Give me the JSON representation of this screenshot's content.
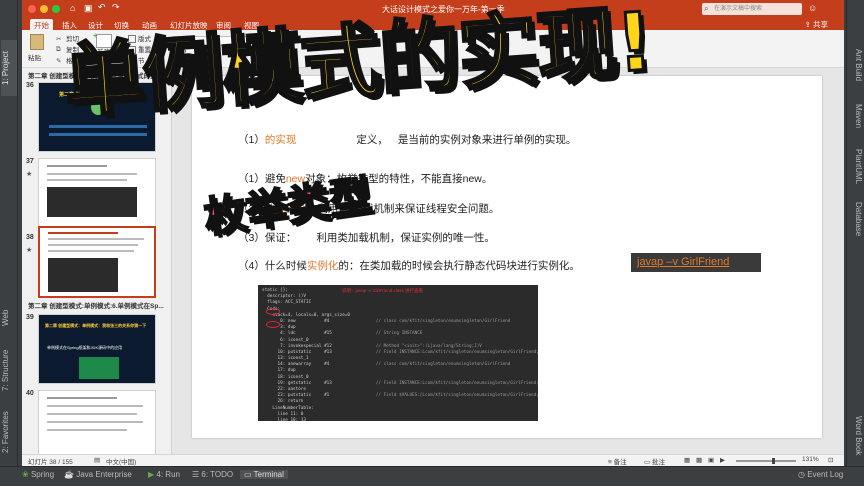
{
  "ide": {
    "left_tabs": [
      "1: Project",
      "7: Structure",
      "Web",
      "2: Favorites"
    ],
    "right_tabs": [
      "Ant Build",
      "Maven",
      "PlantUML",
      "Database",
      "Word Book"
    ],
    "bottom_tabs": [
      "Spring",
      "Java Enterprise",
      "4: Run",
      "6: TODO",
      "Terminal",
      "Event Log"
    ]
  },
  "ppt": {
    "doc_title": "大话设计模式之爱你一万年-第一季",
    "search_placeholder": "在演示文稿中搜索",
    "share_label": "共享",
    "ribbon_tabs": [
      "开始",
      "插入",
      "设计",
      "切换",
      "动画",
      "幻灯片放映",
      "审阅",
      "视图"
    ],
    "ribbon": {
      "paste": "粘贴",
      "cut": "剪切",
      "copy": "复制",
      "format": "格式",
      "new_slide": "新建\n幻灯片",
      "layout": "版式",
      "reset": "重置",
      "section": "节"
    },
    "section_38_label": "第二章 创建型模式:单例模式:5.单例模式的实...",
    "section_39_label": "第二章 创建型模式:单例模式:6.单例模式在Sp...",
    "slide_numbers": [
      "36",
      "37",
      "38",
      "39",
      "40"
    ],
    "thumb36_text": "第二章 创建型模式：单例模式",
    "thumb39_title": "第二章 创建型模式：单例模式：我和张三的关系你猜一下",
    "thumb39_sub": "单例模式在Spring框架和JDK源码中的应用",
    "status": {
      "slide_info": "幻灯片 38 / 155",
      "language": "中文(中国)",
      "notes": "备注",
      "comments": "批注",
      "zoom": "131%"
    }
  },
  "slide": {
    "line1_a": "（1）",
    "line1_b": "的实现",
    "line1_c": "定义，",
    "line1_d": "是当前的实例对象来进行单例的实现。",
    "line2_a": "（1）",
    "line2_b": "避免",
    "line2_c": "new",
    "line2_d": "对象：枚举类型的特性，不能直接",
    "line2_e": "new。",
    "line3_a": "（2）",
    "line3_b": "线程安全",
    "line3_c": "：利用",
    "line3_d": "加载机制来保证线程安全问题。",
    "line4_a": "（3）",
    "line4_b": "保证",
    "line4_c": "：",
    "line4_d": "利用类加载机制，保证实例的唯一性。",
    "line5_a": "（4）什么时候",
    "line5_b": "实例化",
    "line5_c": "的：在类加载的时候会执行静态代码块进行实例化。",
    "javap_label": "javap –v GirlFriend",
    "code_lines": [
      "static {};",
      "  descriptor: ()V",
      "  flags: ACC_STATIC",
      "  Code:",
      "    stack=4, locals=0, args_size=0",
      "       0: new           #4                  // class com/kfit/singleton/enumsingleton/GirlFriend",
      "       3: dup",
      "       4: ldc           #15                 // String INSTANCE",
      "       6: iconst_0",
      "       7: invokespecial #12                 // Method \"<init>\":(Ljava/lang/String;I)V",
      "      10: putstatic     #13                 // Field INSTANCE:Lcom/kfit/singleton/enumsingleton/GirlFriend;",
      "      13: iconst_1",
      "      14: anewarray     #4                  // class com/kfit/singleton/enumsingleton/GirlFriend",
      "      17: dup",
      "      18: iconst_0",
      "      19: getstatic     #13                 // Field INSTANCE:Lcom/kfit/singleton/enumsingleton/GirlFriend;",
      "      22: aastore",
      "      23: putstatic     #1                  // Field $VALUES:[Lcom/kfit/singleton/enumsingleton/GirlFriend;",
      "      26: return",
      "    LineNumberTable:",
      "      line 11: 0",
      "      line 10: 13"
    ],
    "code_annotation": "说明：javap -v GirlFriend.class 进行查看"
  },
  "overlay": {
    "title": "单例模式的实现!",
    "subtitle": "枚举类型"
  },
  "colors": {
    "ppt_red": "#c43e1c",
    "highlight_orange": "#e07a2a",
    "overlay_yellow": "#ffd51a",
    "overlay_pink": "#ff4d8a"
  }
}
